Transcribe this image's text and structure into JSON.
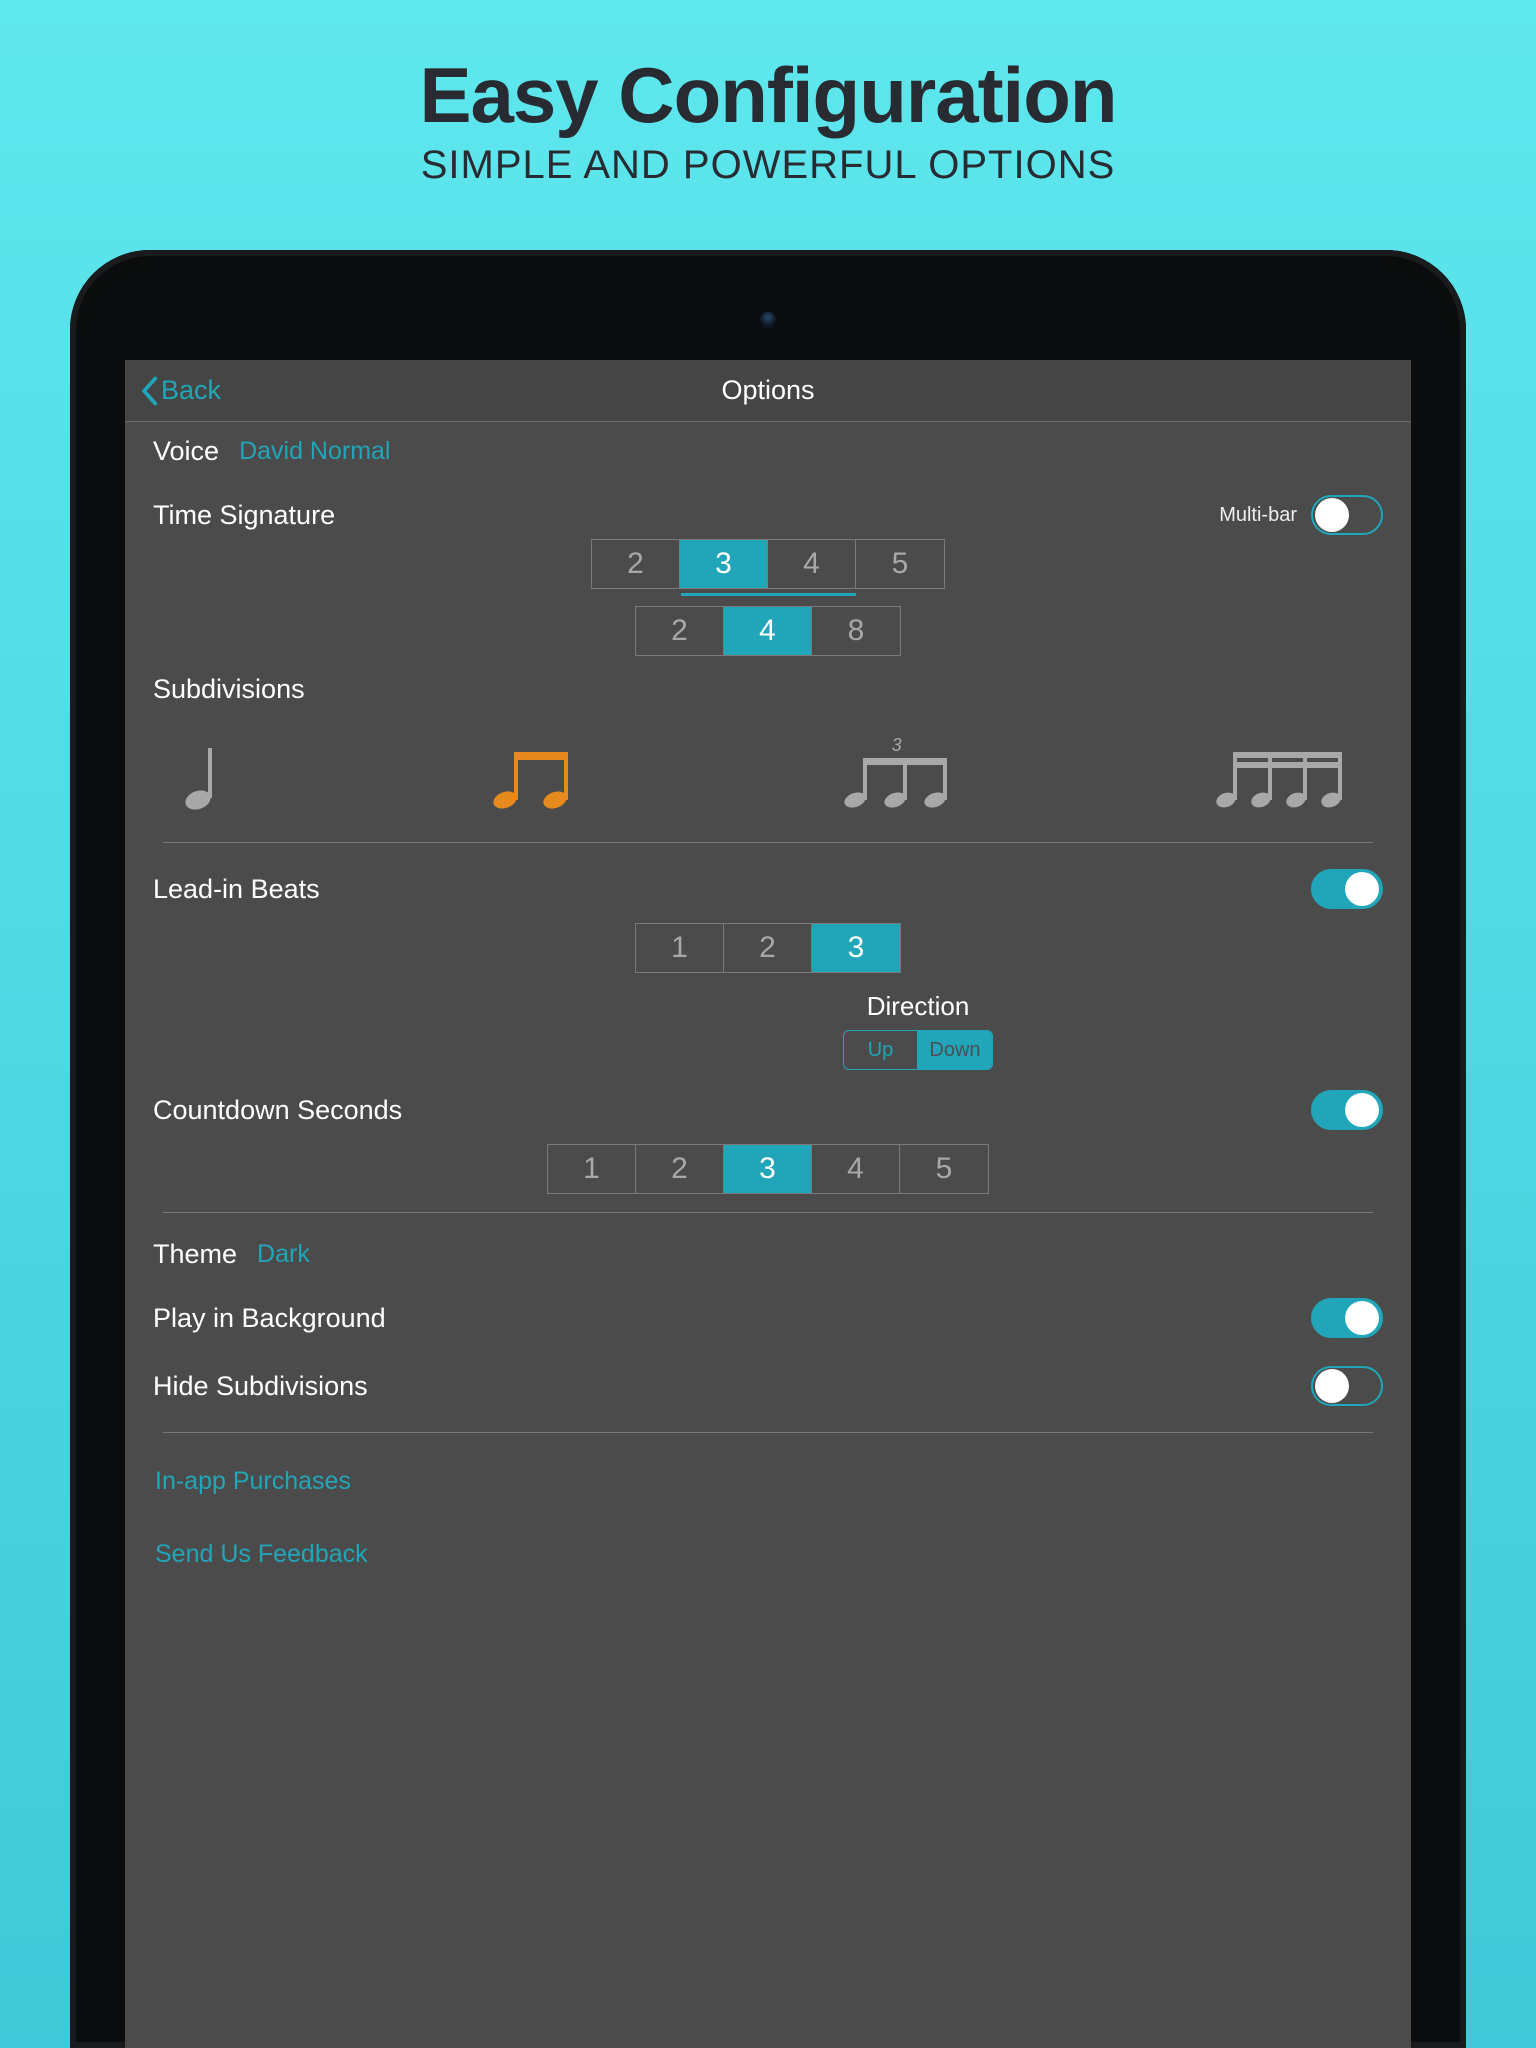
{
  "promo": {
    "title": "Easy Configuration",
    "subtitle": "SIMPLE AND POWERFUL OPTIONS"
  },
  "nav": {
    "back": "Back",
    "title": "Options"
  },
  "voice": {
    "label": "Voice",
    "value": "David Normal"
  },
  "timeSignature": {
    "label": "Time Signature",
    "multiBarLabel": "Multi-bar",
    "multiBarOn": false,
    "numerators": [
      "2",
      "3",
      "4",
      "5"
    ],
    "numeratorSelected": "3",
    "denominators": [
      "2",
      "4",
      "8"
    ],
    "denominatorSelected": "4"
  },
  "subdivisions": {
    "label": "Subdivisions",
    "tripletLabel": "3",
    "options": [
      "quarter",
      "eighth",
      "triplet",
      "sixteenth"
    ],
    "selected": "eighth"
  },
  "leadIn": {
    "label": "Lead-in Beats",
    "on": true,
    "options": [
      "1",
      "2",
      "3"
    ],
    "selected": "3",
    "directionLabel": "Direction",
    "directionOptions": [
      "Up",
      "Down"
    ],
    "directionSelected": "Down"
  },
  "countdown": {
    "label": "Countdown Seconds",
    "on": true,
    "options": [
      "1",
      "2",
      "3",
      "4",
      "5"
    ],
    "selected": "3"
  },
  "theme": {
    "label": "Theme",
    "value": "Dark"
  },
  "playInBackground": {
    "label": "Play in Background",
    "on": true
  },
  "hideSubdivisions": {
    "label": "Hide Subdivisions",
    "on": false
  },
  "links": {
    "iap": "In-app Purchases",
    "feedback": "Send Us Feedback"
  }
}
